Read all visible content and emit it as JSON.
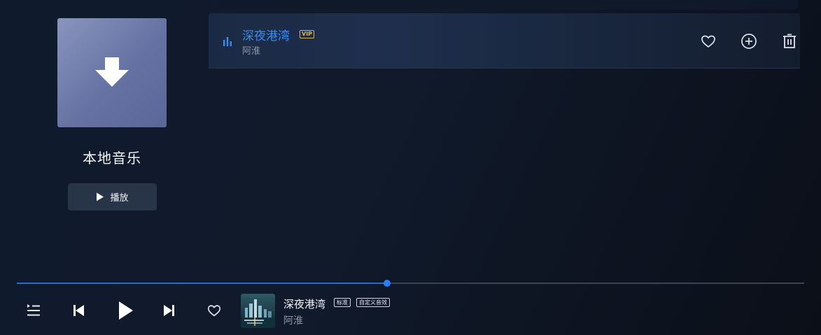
{
  "playlist": {
    "title": "本地音乐",
    "play_label": "播放",
    "cover_icon": "download-arrow-icon"
  },
  "songs": [
    {
      "title": "深夜港湾",
      "badge": "VIP",
      "artist": "阿淮",
      "playing": true,
      "actions": [
        "heart-icon",
        "plus-circle-icon",
        "trash-icon"
      ]
    }
  ],
  "player": {
    "progress": 0.47,
    "now_playing": {
      "title": "深夜港湾",
      "artist": "阿淮",
      "badges": [
        "标准",
        "自定义音效"
      ]
    },
    "controls": [
      "playlist-icon",
      "previous-icon",
      "play-icon",
      "next-icon",
      "heart-icon"
    ]
  },
  "colors": {
    "accent": "#3f8cf2",
    "vip": "#d8b25c",
    "cover_from": "#8a95bd",
    "cover_to": "#5a6798"
  }
}
